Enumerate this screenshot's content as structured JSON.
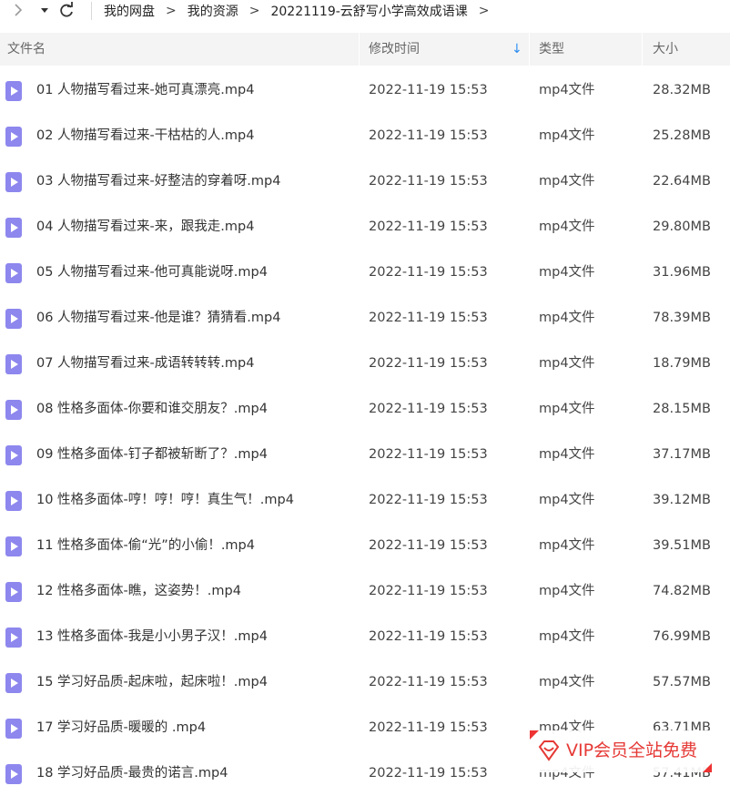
{
  "toolbar": {
    "back_icon": "chevron-right-icon",
    "dropdown_icon": "caret-down-icon",
    "refresh_icon": "refresh-icon",
    "breadcrumb": [
      "我的网盘",
      "我的资源",
      "20221119-云舒写小学高效成语课"
    ],
    "breadcrumb_sep": ">"
  },
  "columns": {
    "name": "文件名",
    "modified": "修改时间",
    "type": "类型",
    "size": "大小",
    "sort_indicator": "↓"
  },
  "files": [
    {
      "name": "01 人物描写看过来-她可真漂亮.mp4",
      "date": "2022-11-19 15:53",
      "type": "mp4文件",
      "size": "28.32MB"
    },
    {
      "name": "02 人物描写看过来-干枯枯的人.mp4",
      "date": "2022-11-19 15:53",
      "type": "mp4文件",
      "size": "25.28MB"
    },
    {
      "name": "03 人物描写看过来-好整洁的穿着呀.mp4",
      "date": "2022-11-19 15:53",
      "type": "mp4文件",
      "size": "22.64MB"
    },
    {
      "name": "04 人物描写看过来-来，跟我走.mp4",
      "date": "2022-11-19 15:53",
      "type": "mp4文件",
      "size": "29.80MB"
    },
    {
      "name": "05 人物描写看过来-他可真能说呀.mp4",
      "date": "2022-11-19 15:53",
      "type": "mp4文件",
      "size": "31.96MB"
    },
    {
      "name": "06 人物描写看过来-他是谁？猜猜看.mp4",
      "date": "2022-11-19 15:53",
      "type": "mp4文件",
      "size": "78.39MB"
    },
    {
      "name": "07 人物描写看过来-成语转转转.mp4",
      "date": "2022-11-19 15:53",
      "type": "mp4文件",
      "size": "18.79MB"
    },
    {
      "name": "08 性格多面体-你要和谁交朋友？.mp4",
      "date": "2022-11-19 15:53",
      "type": "mp4文件",
      "size": "28.15MB"
    },
    {
      "name": "09 性格多面体-钉子都被斩断了？.mp4",
      "date": "2022-11-19 15:53",
      "type": "mp4文件",
      "size": "37.17MB"
    },
    {
      "name": "10 性格多面体-哼！哼！哼！真生气！.mp4",
      "date": "2022-11-19 15:53",
      "type": "mp4文件",
      "size": "39.12MB"
    },
    {
      "name": "11 性格多面体-偷“光”的小偷！.mp4",
      "date": "2022-11-19 15:53",
      "type": "mp4文件",
      "size": "39.51MB"
    },
    {
      "name": "12 性格多面体-瞧，这姿势！.mp4",
      "date": "2022-11-19 15:53",
      "type": "mp4文件",
      "size": "74.82MB"
    },
    {
      "name": "13 性格多面体-我是小小男子汉！.mp4",
      "date": "2022-11-19 15:53",
      "type": "mp4文件",
      "size": "76.99MB"
    },
    {
      "name": "15 学习好品质-起床啦，起床啦！.mp4",
      "date": "2022-11-19 15:53",
      "type": "mp4文件",
      "size": "57.57MB"
    },
    {
      "name": "17 学习好品质-暖暖的 .mp4",
      "date": "2022-11-19 15:53",
      "type": "mp4文件",
      "size": "63.71MB"
    },
    {
      "name": "18 学习好品质-最贵的诺言.mp4",
      "date": "2022-11-19 15:53",
      "type": "mp4文件",
      "size": "57.41MB"
    }
  ],
  "file_icon": "video-file-icon",
  "vip_badge": {
    "icon": "diamond-icon",
    "text": "VIP会员全站免费",
    "color": "#e53935"
  }
}
